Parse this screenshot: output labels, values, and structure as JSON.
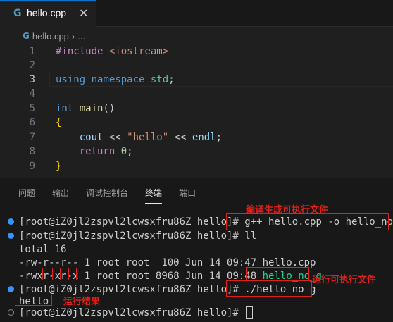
{
  "tab": {
    "icon": "cpp-file-icon",
    "label": "hello.cpp",
    "close": "✕"
  },
  "breadcrumb": {
    "file": "hello.cpp",
    "separator": "›",
    "more": "..."
  },
  "editor": {
    "current_line": 3,
    "line_numbers": [
      "1",
      "2",
      "3",
      "4",
      "5",
      "6",
      "7",
      "8",
      "9"
    ],
    "lines": {
      "l1": {
        "directive": "#include",
        "header": "<iostream>"
      },
      "l3": {
        "using": "using",
        "namespace": "namespace",
        "std": "std",
        "semi": ";"
      },
      "l5": {
        "type": "int",
        "name": "main",
        "parens": "()"
      },
      "l6": {
        "brace": "{"
      },
      "l7": {
        "cout": "cout",
        "op1": " << ",
        "str": "\"hello\"",
        "op2": " << ",
        "endl": "endl",
        "semi": ";"
      },
      "l8": {
        "ret": "return",
        "zero": "0",
        "semi": ";"
      },
      "l9": {
        "brace": "}"
      }
    }
  },
  "panel": {
    "tabs": [
      "问题",
      "输出",
      "调试控制台",
      "终端",
      "端口"
    ],
    "active_tab": "终端"
  },
  "terminal": {
    "prompt": "[root@iZ0jl2zspvl2lcwsxfru86Z hello]# ",
    "cmd1": "g++ hello.cpp -o hello_no_g",
    "cmd2": "ll",
    "total": "total 16",
    "row1": {
      "perms": "-rw-r--r--",
      "rest": " 1 root root  100 Jun 14 09:47 ",
      "name": "hello.cpp"
    },
    "row2": {
      "p1": "-rw",
      "p2": "x",
      "p3": "r-",
      "p4": "x",
      "p5": "r-",
      "p6": "x",
      "rest": " 1 root root 8968 Jun 14 09:48 ",
      "name": "hello_no_g"
    },
    "cmd3": "./hello_no_g",
    "output": "hello"
  },
  "annotations": {
    "compile": "编译生成可执行文件",
    "run_exec": "运行可执行文件",
    "run_result": "运行结果"
  },
  "colors": {
    "annotation": "#e0201b",
    "exec_file": "#23d18b",
    "accent": "#0078d4"
  }
}
